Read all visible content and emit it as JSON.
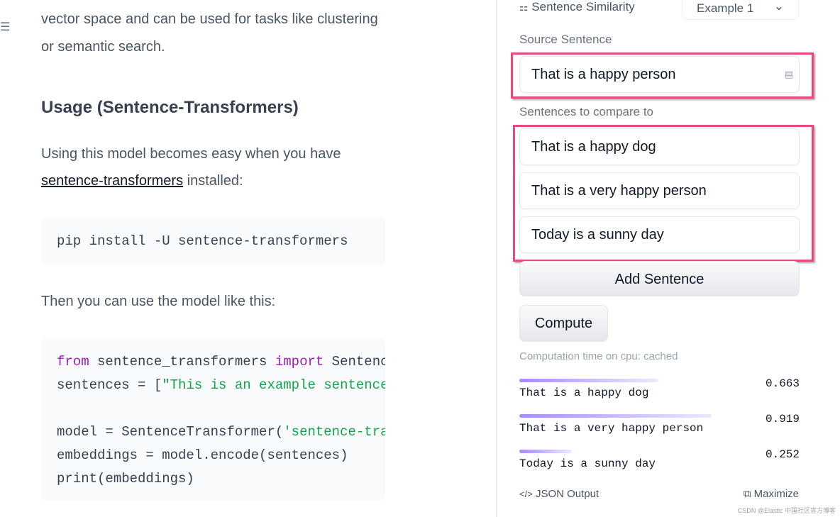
{
  "doc": {
    "intro_line1": "vector space and can be used for tasks like clustering",
    "intro_line2": "or semantic search.",
    "heading": "Usage (Sentence-Transformers)",
    "usage_text": "Using this model becomes easy when you have",
    "usage_link": "sentence-transformers",
    "usage_suffix": " installed:",
    "pip_cmd": "pip install -U sentence-transformers",
    "then_text": "Then you can use the model like this:",
    "code": {
      "l1_kw1": "from",
      "l1_mid": " sentence_transformers ",
      "l1_kw2": "import",
      "l1_end": " Sentenc",
      "l2_a": "sentences = [",
      "l2_str": "\"This is an example sentence",
      "l4_a": "model = SentenceTransformer(",
      "l4_str": "'sentence-tra",
      "l5": "embeddings = model.encode(sentences)",
      "l6": "print(embeddings)"
    }
  },
  "widget": {
    "task_icon": "sentence-similarity-icon",
    "task": "Sentence Similarity",
    "example": "Example 1",
    "source_label": "Source Sentence",
    "source_value": "That is a happy person",
    "compare_label": "Sentences to compare to",
    "sentences": [
      "That is a happy dog",
      "That is a very happy person",
      "Today is a sunny day"
    ],
    "add_button": "Add Sentence",
    "compute_button": "Compute",
    "computation_time": "Computation time on cpu: cached",
    "results": [
      {
        "label": "That is a happy dog",
        "score": "0.663"
      },
      {
        "label": "That is a very happy person",
        "score": "0.919"
      },
      {
        "label": "Today is a sunny day",
        "score": "0.252"
      }
    ],
    "json_output": "JSON Output",
    "maximize": "Maximize"
  },
  "colors": {
    "highlight": "#ec4880",
    "bar": "#a78bfa"
  },
  "watermark": "CSDN @Elastic 中国社区官方博客"
}
